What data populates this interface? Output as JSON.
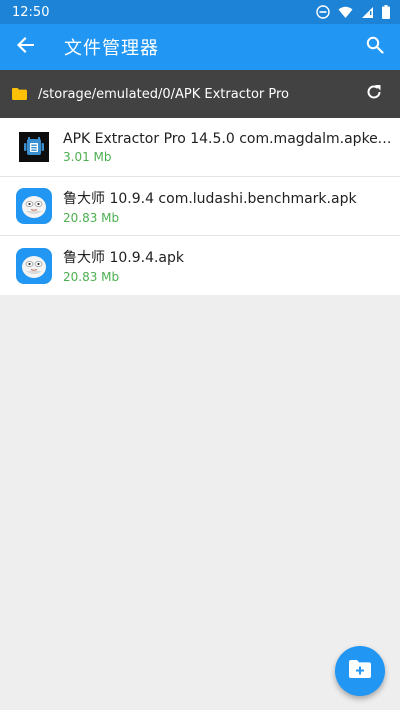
{
  "status_bar": {
    "time": "12:50"
  },
  "app_bar": {
    "title": "文件管理器",
    "back_icon": "arrow-back-icon",
    "search_icon": "search-icon"
  },
  "path_bar": {
    "path": "/storage/emulated/0/APK Extractor Pro",
    "folder_icon": "folder-icon",
    "refresh_icon": "refresh-icon"
  },
  "files": [
    {
      "name": "APK Extractor Pro 14.5.0 com.magdalm.apkextractor.apk",
      "size": "3.01 Mb",
      "icon": "apk-extractor-app-icon"
    },
    {
      "name": "鲁大师 10.9.4 com.ludashi.benchmark.apk",
      "size": "20.83 Mb",
      "icon": "ludashi-app-icon"
    },
    {
      "name": "鲁大师 10.9.4.apk",
      "size": "20.83 Mb",
      "icon": "ludashi-app-icon"
    }
  ],
  "fab": {
    "icon": "new-folder-icon"
  },
  "colors": {
    "primary": "#2196f3",
    "status_bar": "#1c83d6",
    "path_bar": "#424242",
    "size_text": "#4caf50",
    "background": "#eeeeee"
  }
}
